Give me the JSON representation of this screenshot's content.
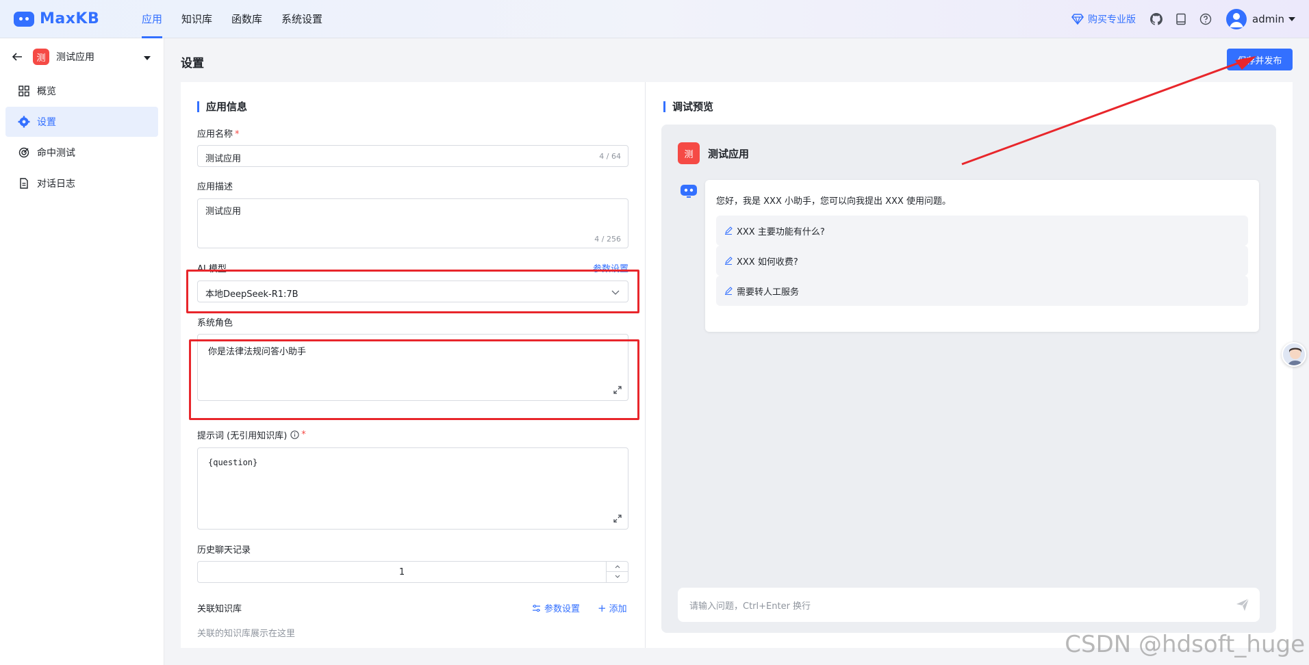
{
  "header": {
    "logo_text": "MaxKB",
    "nav": [
      {
        "label": "应用",
        "active": true
      },
      {
        "label": "知识库",
        "active": false
      },
      {
        "label": "函数库",
        "active": false
      },
      {
        "label": "系统设置",
        "active": false
      }
    ],
    "buy_label": "购买专业版",
    "user_name": "admin",
    "icons": [
      "diamond-icon",
      "github-icon",
      "book-icon",
      "help-icon",
      "avatar",
      "caret-down-icon"
    ]
  },
  "sidebar": {
    "app_badge": "测",
    "app_name": "测试应用",
    "items": [
      {
        "label": "概览",
        "icon": "grid-icon",
        "active": false
      },
      {
        "label": "设置",
        "icon": "gear-icon",
        "active": true
      },
      {
        "label": "命中测试",
        "icon": "target-icon",
        "active": false
      },
      {
        "label": "对话日志",
        "icon": "document-icon",
        "active": false
      }
    ]
  },
  "page": {
    "title": "设置",
    "save_label": "保存并发布"
  },
  "app_info": {
    "section_title": "应用信息",
    "name_label": "应用名称",
    "name_value": "测试应用",
    "name_counter": "4 / 64",
    "desc_label": "应用描述",
    "desc_value": "测试应用",
    "desc_counter": "4 / 256",
    "model_label": "AI 模型",
    "model_param_link": "参数设置",
    "model_value": "本地DeepSeek-R1:7B",
    "role_label": "系统角色",
    "role_value": "你是法律法规问答小助手",
    "prompt_label": "提示词 (无引用知识库)",
    "prompt_value": "{question}",
    "history_label": "历史聊天记录",
    "history_value": "1",
    "kb_label": "关联知识库",
    "kb_param_link": "参数设置",
    "kb_add_link": "添加",
    "kb_placeholder": "关联的知识库展示在这里"
  },
  "preview": {
    "section_title": "调试预览",
    "app_badge": "测",
    "app_name": "测试应用",
    "greeting": "您好，我是 XXX 小助手，您可以向我提出 XXX 使用问题。",
    "suggestions": [
      "XXX 主要功能有什么?",
      "XXX 如何收费?",
      "需要转人工服务"
    ],
    "input_placeholder": "请输入问题，Ctrl+Enter 换行"
  },
  "watermark": "CSDN @hdsoft_huge",
  "colors": {
    "accent": "#3370ff",
    "badge": "#f54a45",
    "annotation": "#e8262b"
  }
}
